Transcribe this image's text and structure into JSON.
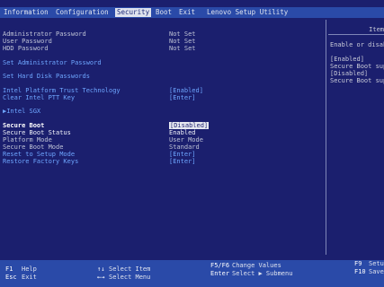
{
  "topbar": {
    "tabs": [
      "Information",
      "Configuration",
      "Security",
      "Boot",
      "Exit"
    ],
    "title": "Lenovo Setup Utility"
  },
  "security": {
    "passwords": [
      {
        "label": "Administrator Password",
        "value": "Not Set"
      },
      {
        "label": "User Password",
        "value": "Not Set"
      },
      {
        "label": "HDD Password",
        "value": "Not Set"
      }
    ],
    "set_admin_password": "Set Administrator Password",
    "set_hdd_passwords": "Set Hard Disk Passwords",
    "ptt": {
      "label": "Intel Platform Trust Technology",
      "value": "[Enabled]"
    },
    "clear_ptt": {
      "label": "Clear Intel PTT Key",
      "value": "[Enter]"
    },
    "sgx": "▶Intel SGX",
    "secure_boot": {
      "label": "Secure Boot",
      "value": "[Disabled]"
    },
    "secure_boot_status": {
      "label": "Secure Boot Status",
      "value": "Enabled"
    },
    "platform_mode": {
      "label": "Platform Mode",
      "value": "User Mode"
    },
    "secure_boot_mode": {
      "label": "Secure Boot Mode",
      "value": "Standard"
    },
    "reset_setup_mode": {
      "label": "Reset to Setup Mode",
      "value": "[Enter]"
    },
    "restore_factory_keys": {
      "label": "Restore Factory Keys",
      "value": "[Enter]"
    }
  },
  "help_panel": {
    "header": "Item",
    "lines": [
      "Enable or disab",
      "[Enabled]",
      "Secure Boot sup",
      "[Disabled]",
      "Secure Boot sup"
    ]
  },
  "bottombar": {
    "f1": {
      "key": "F1",
      "desc": "Help"
    },
    "esc": {
      "key": "Esc",
      "desc": "Exit"
    },
    "updown": {
      "key": "↑↓",
      "desc": "Select Item"
    },
    "leftright": {
      "key": "←→",
      "desc": "Select Menu"
    },
    "f5f6": {
      "key": "F5/F6",
      "desc": "Change Values"
    },
    "enter": {
      "key": "Enter",
      "desc": "Select ▶ Submenu"
    },
    "f9": {
      "key": "F9",
      "desc": "Setup"
    },
    "f10": {
      "key": "F10",
      "desc": "Save"
    }
  }
}
